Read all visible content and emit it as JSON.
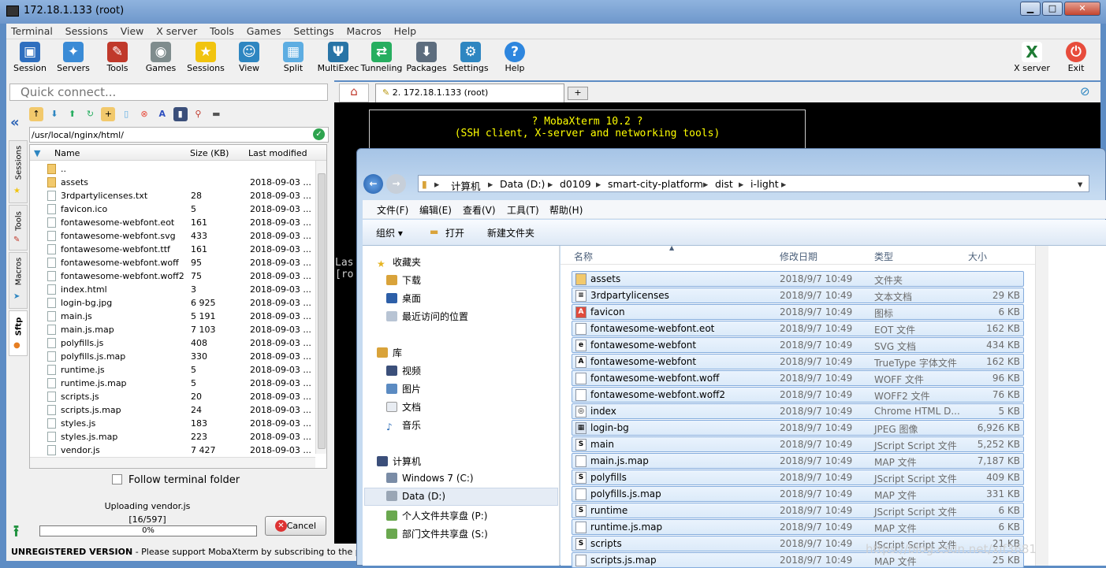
{
  "window": {
    "title": "172.18.1.133 (root)",
    "min": "▁",
    "max": "□",
    "close": "✕"
  },
  "menu": [
    "Terminal",
    "Sessions",
    "View",
    "X server",
    "Tools",
    "Games",
    "Settings",
    "Macros",
    "Help"
  ],
  "toolbar": {
    "items": [
      {
        "label": "Session",
        "icon": "monitor-icon",
        "color": "#2f6fbf"
      },
      {
        "label": "Servers",
        "icon": "network-icon",
        "color": "#3a8bd6"
      },
      {
        "label": "Tools",
        "icon": "wrench-icon",
        "color": "#c0392b"
      },
      {
        "label": "Games",
        "icon": "gamepad-icon",
        "color": "#7f8c8d"
      },
      {
        "label": "Sessions",
        "icon": "star-icon",
        "color": "#f1c40f"
      },
      {
        "label": "View",
        "icon": "person-icon",
        "color": "#2e86c1"
      },
      {
        "label": "Split",
        "icon": "split-icon",
        "color": "#5dade2"
      },
      {
        "label": "MultiExec",
        "icon": "fork-icon",
        "color": "#2874a6"
      },
      {
        "label": "Tunneling",
        "icon": "tunnel-icon",
        "color": "#27ae60"
      },
      {
        "label": "Packages",
        "icon": "package-icon",
        "color": "#5d6d7e"
      },
      {
        "label": "Settings",
        "icon": "gears-icon",
        "color": "#2e86c1"
      },
      {
        "label": "Help",
        "icon": "help-icon",
        "color": "#2e86de"
      }
    ],
    "xserver": "X server",
    "exit": "Exit"
  },
  "quick_connect": {
    "placeholder": "Quick connect..."
  },
  "sidetabs": [
    "Sessions",
    "Tools",
    "Macros",
    "Sftp"
  ],
  "sftp": {
    "path": "/usr/local/nginx/html/",
    "columns": {
      "name": "Name",
      "size": "Size (KB)",
      "modified": "Last modified"
    },
    "files": [
      {
        "name": "..",
        "size": "",
        "modified": "",
        "type": "dir"
      },
      {
        "name": "assets",
        "size": "",
        "modified": "2018-09-03 ...",
        "type": "dir"
      },
      {
        "name": "3rdpartylicenses.txt",
        "size": "28",
        "modified": "2018-09-03 ...",
        "type": "file"
      },
      {
        "name": "favicon.ico",
        "size": "5",
        "modified": "2018-09-03 ...",
        "type": "file"
      },
      {
        "name": "fontawesome-webfont.eot",
        "size": "161",
        "modified": "2018-09-03 ...",
        "type": "file"
      },
      {
        "name": "fontawesome-webfont.svg",
        "size": "433",
        "modified": "2018-09-03 ...",
        "type": "file"
      },
      {
        "name": "fontawesome-webfont.ttf",
        "size": "161",
        "modified": "2018-09-03 ...",
        "type": "file"
      },
      {
        "name": "fontawesome-webfont.woff",
        "size": "95",
        "modified": "2018-09-03 ...",
        "type": "file"
      },
      {
        "name": "fontawesome-webfont.woff2",
        "size": "75",
        "modified": "2018-09-03 ...",
        "type": "file"
      },
      {
        "name": "index.html",
        "size": "3",
        "modified": "2018-09-03 ...",
        "type": "file"
      },
      {
        "name": "login-bg.jpg",
        "size": "6 925",
        "modified": "2018-09-03 ...",
        "type": "file"
      },
      {
        "name": "main.js",
        "size": "5 191",
        "modified": "2018-09-03 ...",
        "type": "file"
      },
      {
        "name": "main.js.map",
        "size": "7 103",
        "modified": "2018-09-03 ...",
        "type": "file"
      },
      {
        "name": "polyfills.js",
        "size": "408",
        "modified": "2018-09-03 ...",
        "type": "file"
      },
      {
        "name": "polyfills.js.map",
        "size": "330",
        "modified": "2018-09-03 ...",
        "type": "file"
      },
      {
        "name": "runtime.js",
        "size": "5",
        "modified": "2018-09-03 ...",
        "type": "file"
      },
      {
        "name": "runtime.js.map",
        "size": "5",
        "modified": "2018-09-03 ...",
        "type": "file"
      },
      {
        "name": "scripts.js",
        "size": "20",
        "modified": "2018-09-03 ...",
        "type": "file"
      },
      {
        "name": "scripts.js.map",
        "size": "24",
        "modified": "2018-09-03 ...",
        "type": "file"
      },
      {
        "name": "styles.js",
        "size": "183",
        "modified": "2018-09-03 ...",
        "type": "file"
      },
      {
        "name": "styles.js.map",
        "size": "223",
        "modified": "2018-09-03 ...",
        "type": "file"
      },
      {
        "name": "vendor.js",
        "size": "7 427",
        "modified": "2018-09-03 ...",
        "type": "file"
      }
    ],
    "follow_label": "Follow terminal folder",
    "upload_text": "Uploading vendor.js",
    "upload_count": "[16/597]",
    "progress": "0%",
    "progress_fraction": 0.0,
    "cancel": "Cancel"
  },
  "status": {
    "bold": "UNREGISTERED VERSION",
    "text": "  -  Please support MobaXterm by subscribing to the professiona"
  },
  "terminal": {
    "tab_label": "2. 172.18.1.133 (root)",
    "banner1": "? MobaXterm 10.2 ?",
    "banner2": "(SSH client, X-server and networking tools)",
    "line1": "Las",
    "line2": "[ro"
  },
  "explorer": {
    "breadcrumb": [
      "计算机",
      "Data (D:)",
      "d0109",
      "smart-city-platform",
      "dist",
      "i-light"
    ],
    "menu": [
      "文件(F)",
      "编辑(E)",
      "查看(V)",
      "工具(T)",
      "帮助(H)"
    ],
    "tools": {
      "organize": "组织 ▾",
      "open": "打开",
      "new_folder": "新建文件夹"
    },
    "nav": {
      "favorites": "收藏夹",
      "downloads": "下载",
      "desktop": "桌面",
      "recent": "最近访问的位置",
      "libraries": "库",
      "videos": "视频",
      "pictures": "图片",
      "documents": "文档",
      "music": "音乐",
      "computer": "计算机",
      "drive_c": "Windows 7 (C:)",
      "drive_d": "Data (D:)",
      "drive_p": "个人文件共享盘 (P:)",
      "drive_s": "部门文件共享盘 (S:)"
    },
    "columns": {
      "name": "名称",
      "date": "修改日期",
      "type": "类型",
      "size": "大小"
    },
    "files": [
      {
        "name": "assets",
        "date": "2018/9/7 10:49",
        "type": "文件夹",
        "size": "",
        "icon": "folder"
      },
      {
        "name": "3rdpartylicenses",
        "date": "2018/9/7 10:49",
        "type": "文本文档",
        "size": "29 KB",
        "icon": "txt"
      },
      {
        "name": "favicon",
        "date": "2018/9/7 10:49",
        "type": "图标",
        "size": "6 KB",
        "icon": "ico"
      },
      {
        "name": "fontawesome-webfont.eot",
        "date": "2018/9/7 10:49",
        "type": "EOT 文件",
        "size": "162 KB",
        "icon": "file"
      },
      {
        "name": "fontawesome-webfont",
        "date": "2018/9/7 10:49",
        "type": "SVG 文档",
        "size": "434 KB",
        "icon": "svg"
      },
      {
        "name": "fontawesome-webfont",
        "date": "2018/9/7 10:49",
        "type": "TrueType 字体文件",
        "size": "162 KB",
        "icon": "ttf"
      },
      {
        "name": "fontawesome-webfont.woff",
        "date": "2018/9/7 10:49",
        "type": "WOFF 文件",
        "size": "96 KB",
        "icon": "file"
      },
      {
        "name": "fontawesome-webfont.woff2",
        "date": "2018/9/7 10:49",
        "type": "WOFF2 文件",
        "size": "76 KB",
        "icon": "file"
      },
      {
        "name": "index",
        "date": "2018/9/7 10:49",
        "type": "Chrome HTML D...",
        "size": "5 KB",
        "icon": "chrome"
      },
      {
        "name": "login-bg",
        "date": "2018/9/7 10:49",
        "type": "JPEG 图像",
        "size": "6,926 KB",
        "icon": "img"
      },
      {
        "name": "main",
        "date": "2018/9/7 10:49",
        "type": "JScript Script 文件",
        "size": "5,252 KB",
        "icon": "js"
      },
      {
        "name": "main.js.map",
        "date": "2018/9/7 10:49",
        "type": "MAP 文件",
        "size": "7,187 KB",
        "icon": "file"
      },
      {
        "name": "polyfills",
        "date": "2018/9/7 10:49",
        "type": "JScript Script 文件",
        "size": "409 KB",
        "icon": "js"
      },
      {
        "name": "polyfills.js.map",
        "date": "2018/9/7 10:49",
        "type": "MAP 文件",
        "size": "331 KB",
        "icon": "file"
      },
      {
        "name": "runtime",
        "date": "2018/9/7 10:49",
        "type": "JScript Script 文件",
        "size": "6 KB",
        "icon": "js"
      },
      {
        "name": "runtime.js.map",
        "date": "2018/9/7 10:49",
        "type": "MAP 文件",
        "size": "6 KB",
        "icon": "file"
      },
      {
        "name": "scripts",
        "date": "2018/9/7 10:49",
        "type": "JScript Script 文件",
        "size": "21 KB",
        "icon": "js"
      },
      {
        "name": "scripts.js.map",
        "date": "2018/9/7 10:49",
        "type": "MAP 文件",
        "size": "25 KB",
        "icon": "file"
      }
    ]
  },
  "watermark": "https://blog.csdn.net/xif3681"
}
